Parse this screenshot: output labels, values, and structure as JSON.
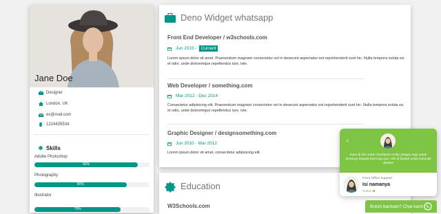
{
  "profile": {
    "name": "Jane Doe",
    "job": "Designer",
    "location": "London, UK",
    "email": "ex@mail.com",
    "phone": "1224435534"
  },
  "skills": {
    "title": "Skills",
    "items": [
      {
        "label": "Adobe Photoshop",
        "percent": 90,
        "percent_text": "90%"
      },
      {
        "label": "Photography",
        "percent": 80,
        "percent_text": "80%"
      },
      {
        "label": "Illustrator",
        "percent": 75,
        "percent_text": "75%"
      }
    ]
  },
  "experience": {
    "title": "Deno Widget whatsapp",
    "jobs": [
      {
        "title": "Front End Developer / w3schools.com",
        "date": "Jun 2015 - ",
        "badge": "Current",
        "desc": "Lorem ipsum dolor sit amet. Praesentium magnam consectetur vel in deserunt aspernatur est reprehenderit sunt hic. Nulla tempora soluta ea et odio, unde doloremque repellendus iure, iste."
      },
      {
        "title": "Web Developer / something.com",
        "date": "Mar 2012 - Dec 2014",
        "desc": "Consectetur adipisicing elit. Praesentium magnam consectetur vel in deserunt aspernatur est reprehenderit sunt hic. Nulla tempora soluta ea et odio, unde doloremque repellendus iure, iste."
      },
      {
        "title": "Graphic Designer / designsomething.com",
        "date": "Jun 2010 - Mar 2012",
        "desc": "Lorem ipsum dolor sit amet, consectetur adipisicing elit."
      }
    ]
  },
  "education": {
    "title": "Education",
    "school": "W3Schools.com"
  },
  "whatsapp": {
    "message": "Kami di sini untuk membantu Anda! Jangan ragu untuk bertanya kepada kami apa pun. Klik di bawah untuk memulai obrolan",
    "agent_role": "Front Office Support",
    "agent_name": "Isi namanya",
    "status": "Online",
    "cta": "Butuh bantuan? Chat kami"
  },
  "colors": {
    "accent": "#009688",
    "whatsapp_green": "#7ec543"
  }
}
